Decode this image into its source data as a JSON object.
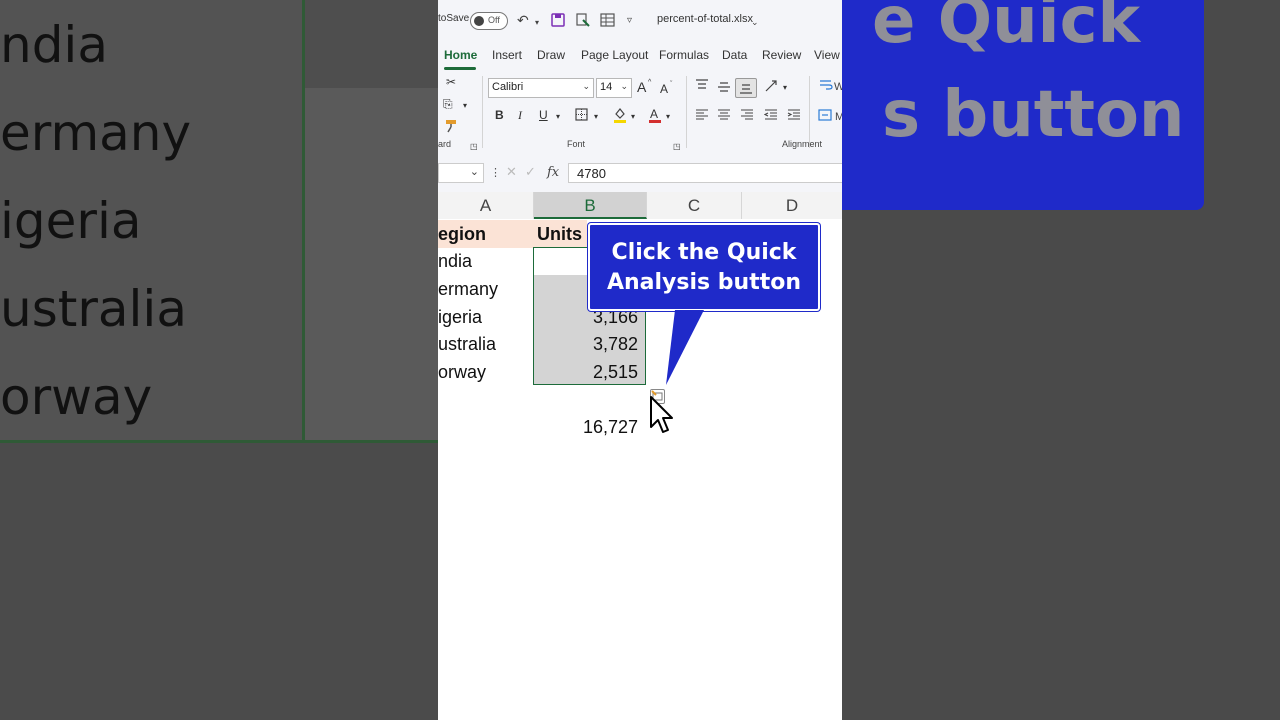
{
  "background": {
    "left_words": [
      "ndia",
      "ermany",
      "igeria",
      "ustralia",
      "orway"
    ],
    "banner_lines": [
      "e Quick",
      "s button"
    ],
    "banner_color": "#1f2ac9"
  },
  "titlebar": {
    "autosave_label": "toSave",
    "toggle_state": "Off",
    "filename": "percent-of-total.xlsx",
    "icons": [
      "undo-icon",
      "save-icon",
      "copy-format-icon",
      "table-icon",
      "customize-icon"
    ]
  },
  "tabs": [
    "Home",
    "Insert",
    "Draw",
    "Page Layout",
    "Formulas",
    "Data",
    "Review",
    "View"
  ],
  "active_tab": "Home",
  "ribbon": {
    "clipboard_label": "ard",
    "font_name": "Calibri",
    "font_size": "14",
    "bold": "B",
    "italic": "I",
    "underline": "U",
    "grow_font": "A",
    "shrink_font": "A",
    "font_group_label": "Font",
    "alignment_group_label": "Alignment",
    "wrap_fragment": "W",
    "merge_fragment": "M",
    "font_color": "#d32f2f",
    "fill_color": "#f5d700"
  },
  "formula_bar": {
    "value": "4780",
    "fx": "fx"
  },
  "columns": [
    "A",
    "B",
    "C",
    "D"
  ],
  "selected_column": "B",
  "sheet": {
    "header": [
      "egion",
      "Units"
    ],
    "rows": [
      {
        "region": "ndia",
        "units": ""
      },
      {
        "region": "ermany",
        "units": ""
      },
      {
        "region": "igeria",
        "units": "3,166"
      },
      {
        "region": "ustralia",
        "units": "3,782"
      },
      {
        "region": "orway",
        "units": "2,515"
      }
    ],
    "total": "16,727"
  },
  "callout": {
    "line1": "Click the Quick",
    "line2": "Analysis button",
    "color": "#1f2ac9"
  },
  "accent_color": "#1d6b3a"
}
